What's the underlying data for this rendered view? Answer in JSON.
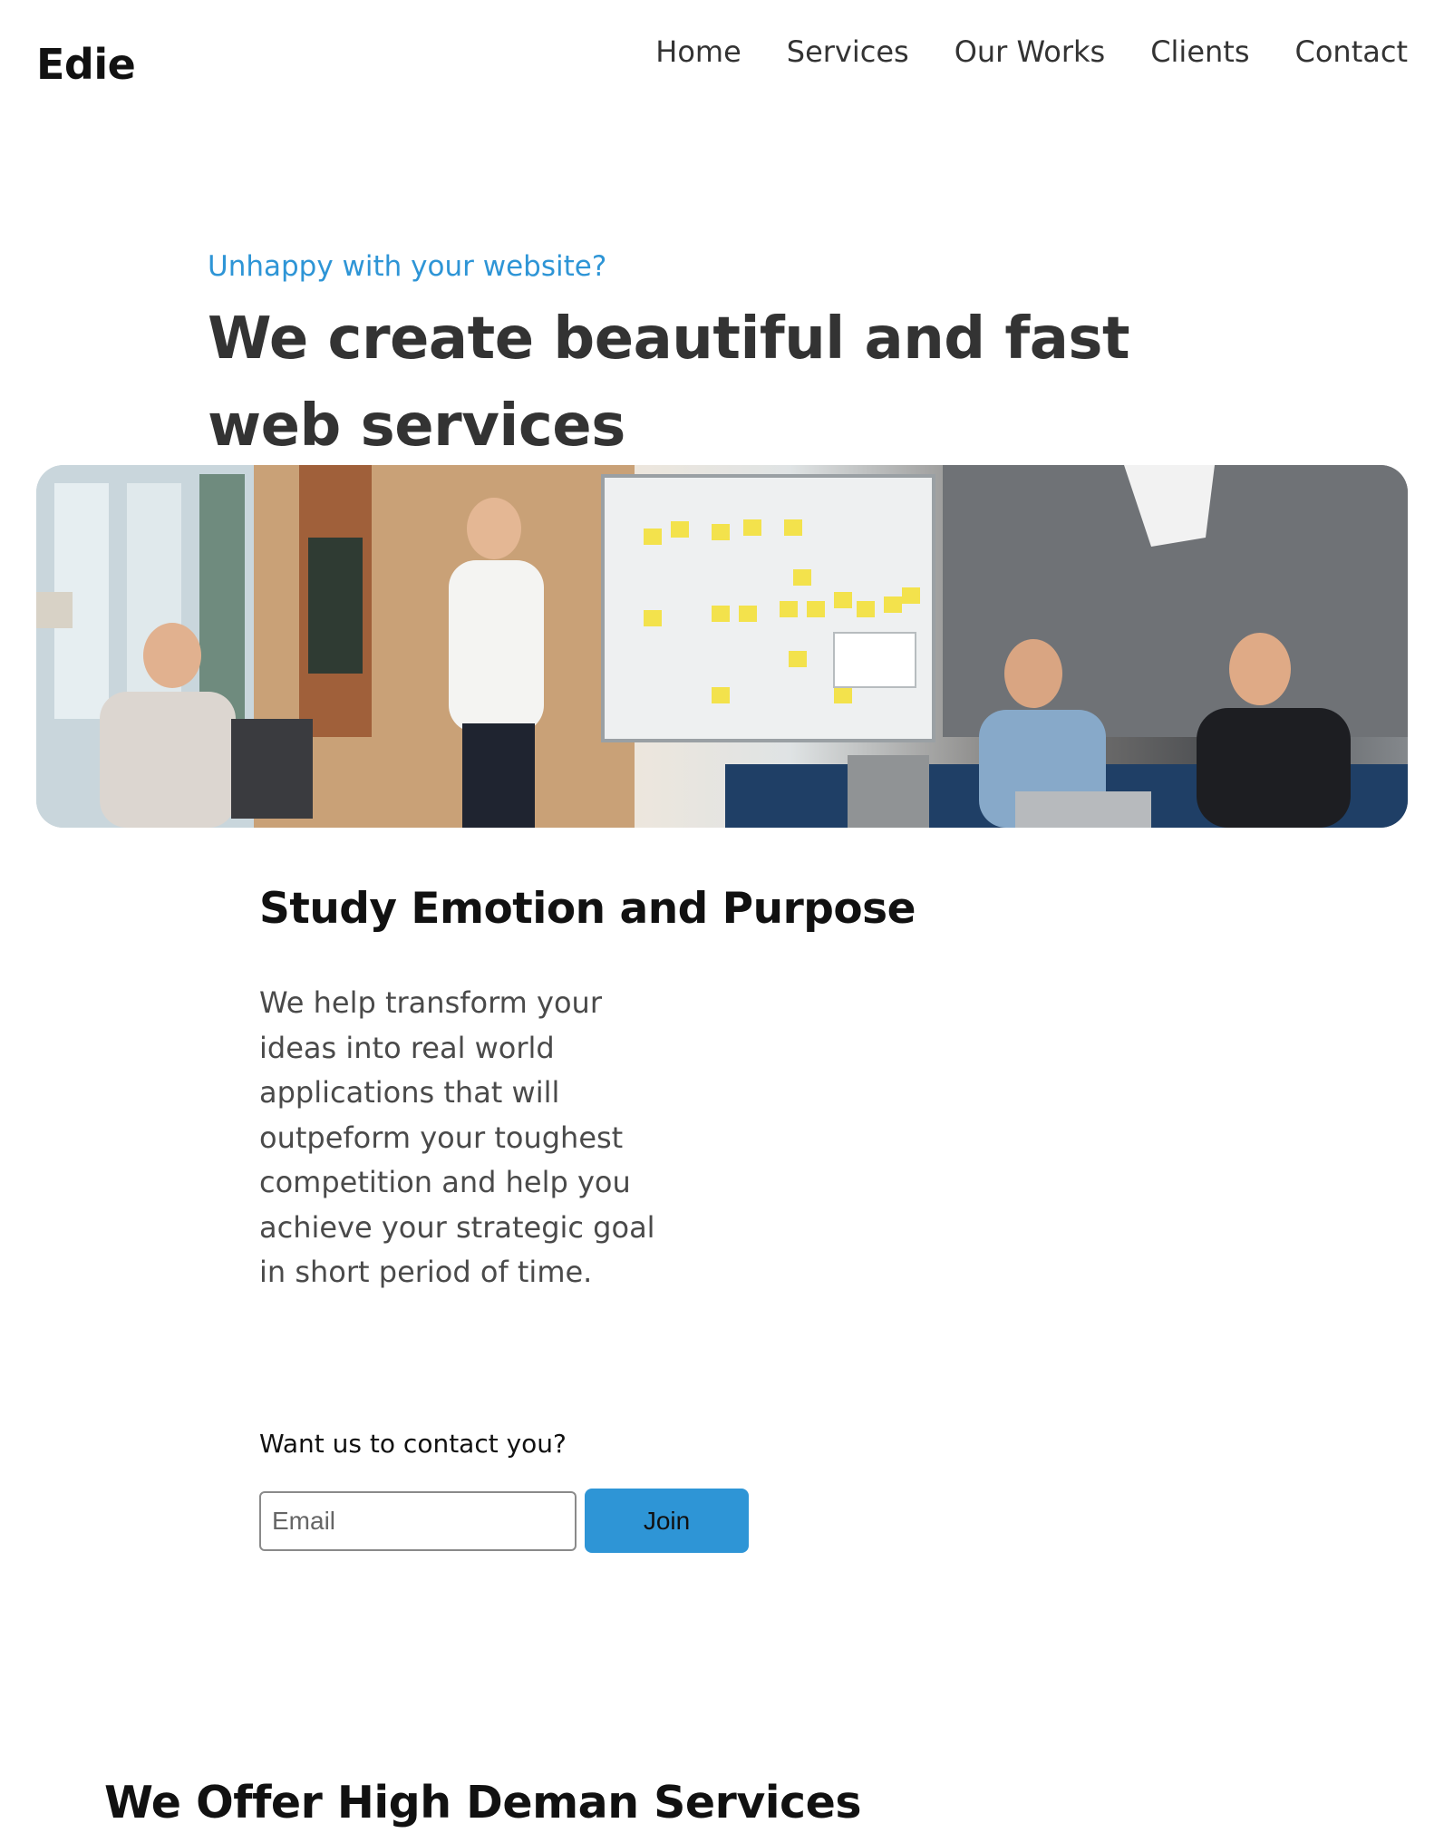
{
  "header": {
    "logo": "Edie",
    "nav": [
      "Home",
      "Services",
      "Our Works",
      "Clients",
      "Contact"
    ]
  },
  "hero": {
    "kicker": "Unhappy with your website?",
    "title": "We create beautiful and fast web services"
  },
  "section": {
    "title": "Study Emotion and Purpose",
    "text": "We help transform your ideas into real world applications that will outpeform your toughest competition and help you achieve your strategic goal in short period of time."
  },
  "contact": {
    "label": "Want us to contact you?",
    "email_placeholder": "Email",
    "join_label": "Join"
  },
  "offer": {
    "title": "We Offer High Deman Services"
  },
  "colors": {
    "accent": "#2e95d6",
    "text_dark": "#333333"
  }
}
